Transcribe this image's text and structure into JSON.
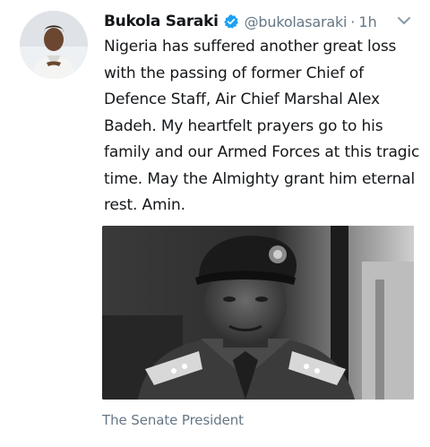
{
  "tweet": {
    "author_name": "Bukola Saraki",
    "handle": "@bukolasaraki",
    "separator": "·",
    "time": "1h",
    "text": "Nigeria has suffered another great loss with the passing of former Chief of Defence Staff, Air Chief Marshal Alex Badeh. My heartfelt prayers go to his family and our Armed Forces at this tragic time. May the Almighty grant him eternal rest. Amin.",
    "caption": "The Senate President",
    "icons": {
      "verified": "verified-badge-icon",
      "menu": "chevron-down-icon"
    },
    "colors": {
      "verified": "#1da1f2",
      "secondary_text": "#657786",
      "primary_text": "#14171a"
    }
  }
}
